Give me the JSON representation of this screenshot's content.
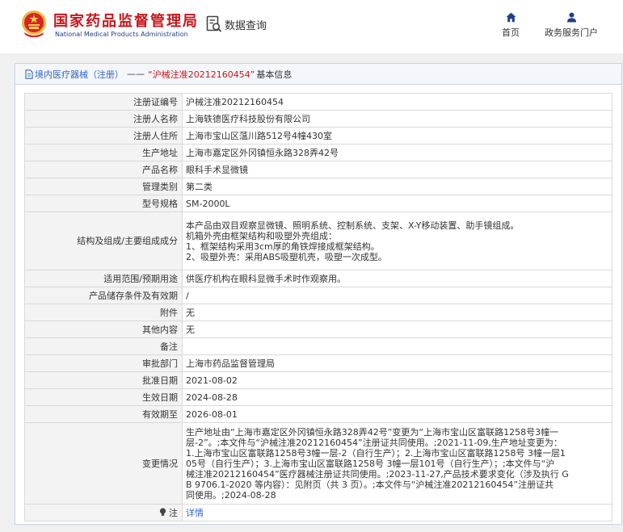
{
  "header": {
    "brand_cn": "国家药品监督管理局",
    "brand_en": "National Medical Products Administration",
    "query_label": "数据查询",
    "nav": [
      {
        "label": "首页",
        "icon": "home-icon"
      },
      {
        "label": "政务服务门户",
        "icon": "user-icon"
      }
    ]
  },
  "panel": {
    "title_link": "境内医疗器械（注册）",
    "title_sep": "——",
    "title_quote": "“沪械注准20212160454”",
    "title_suffix": "基本信息"
  },
  "rows": {
    "reg_no": {
      "k": "注册证编号",
      "v": "沪械注准20212160454"
    },
    "registrant": {
      "k": "注册人名称",
      "v": "上海轶德医疗科技股份有限公司"
    },
    "registrant_addr": {
      "k": "注册人住所",
      "v": "上海市宝山区蕰川路512号4幢430室"
    },
    "production_addr": {
      "k": "生产地址",
      "v": "上海市嘉定区外冈镇恒永路328弄42号"
    },
    "product_name": {
      "k": "产品名称",
      "v": "眼科手术显微镜"
    },
    "category": {
      "k": "管理类别",
      "v": "第二类"
    },
    "model": {
      "k": "型号规格",
      "v": "SM-2000L"
    },
    "structure": {
      "k": "结构及组成/主要组成成分",
      "lines": [
        "本产品由双目观察显微镜、照明系统、控制系统、支架、X-Y移动装置、助手镜组成。",
        "机箱外壳由框架结构和吸塑外壳组成：",
        "1、框架结构采用3cm厚的角铁焊接成框架结构。",
        "2、吸塑外壳：采用ABS吸塑机壳，吸塑一次成型。"
      ]
    },
    "scope": {
      "k": "适用范围/预期用途",
      "v": "供医疗机构在眼科显微手术时作观察用。"
    },
    "storage": {
      "k": "产品储存条件及有效期",
      "v": "/"
    },
    "attachment": {
      "k": "附件",
      "v": "无"
    },
    "other": {
      "k": "其他内容",
      "v": "无"
    },
    "remark": {
      "k": "备注",
      "v": ""
    },
    "approval_dept": {
      "k": "审批部门",
      "v": "上海市药品监督管理局"
    },
    "approval_date": {
      "k": "批准日期",
      "v": "2021-08-02"
    },
    "effective_date": {
      "k": "生效日期",
      "v": "2024-08-28"
    },
    "expiry_date": {
      "k": "有效期至",
      "v": "2026-08-01"
    },
    "changes": {
      "k": "变更情况",
      "lines": [
        "生产地址由“上海市嘉定区外冈镇恒永路328弄42号”变更为“上海市宝山区富联路1258号3幢一",
        "层-2”。;本文件与“沪械注准20212160454”注册证共同使用。;2021-11-09,生产地址变更为：",
        "1.上海市宝山区富联路1258号3幢一层-2（自行生产）；2.上海市宝山区富联路1258号 3幢一层1",
        "05号（自行生产）；3.上海市宝山区富联路1258号 3幢一层101号（自行生产）；;本文件与“沪",
        "械注准20212160454”医疗器械注册证共同使用。;2023-11-27,产品技术要求变化（涉及执行 G",
        "B 9706.1-2020 等内容）：见附页（共 3 页）。;本文件与“沪械注准20212160454”注册证共",
        "同使用。;2024-08-28"
      ]
    },
    "note": {
      "k": "注",
      "v": "详情"
    }
  },
  "colors": {
    "brand_red": "#c8161d",
    "brand_blue": "#1e3f86",
    "link_blue": "#3366cc"
  }
}
